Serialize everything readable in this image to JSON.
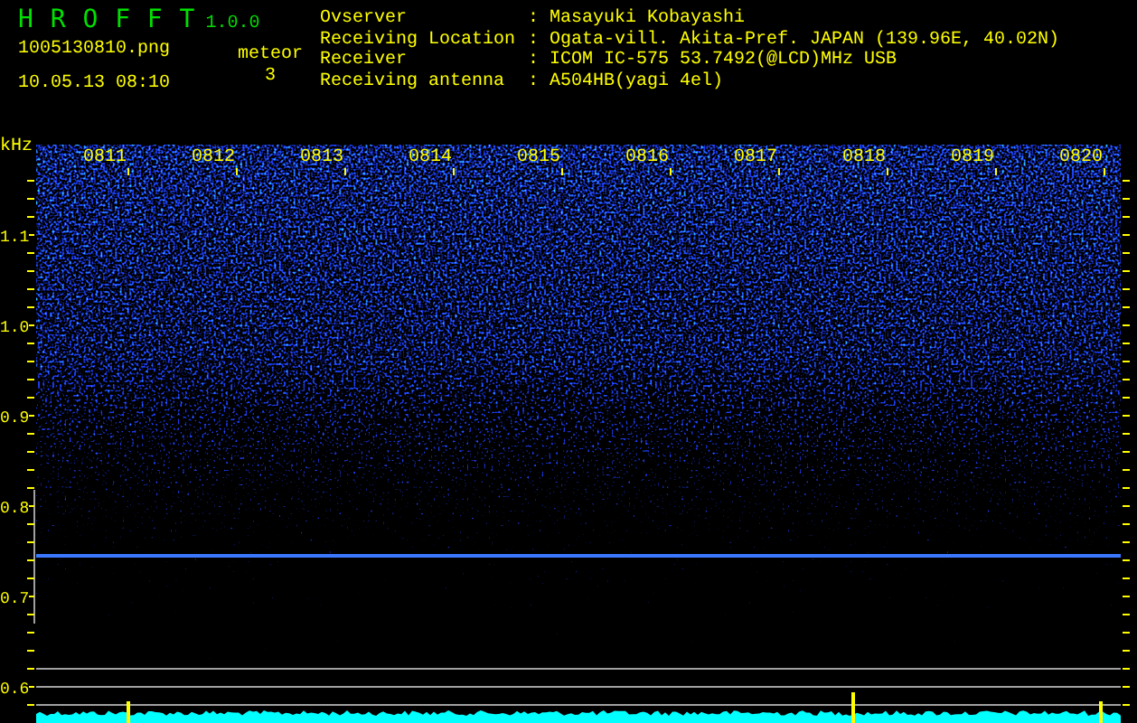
{
  "app": {
    "title": "H R O F F T",
    "version": "1.0.0"
  },
  "file": {
    "name": "1005130810.png",
    "datetime": "10.05.13 08:10"
  },
  "meteor": {
    "label": "meteor",
    "count": "3"
  },
  "info": [
    {
      "label": "Ovserver",
      "separator": ":",
      "value": "Masayuki Kobayashi"
    },
    {
      "label": "Receiving Location",
      "separator": ":",
      "value": "Ogata-vill. Akita-Pref. JAPAN (139.96E, 40.02N)"
    },
    {
      "label": "Receiver",
      "separator": ":",
      "value": "ICOM IC-575 53.7492(@LCD)MHz USB"
    },
    {
      "label": "Receiving antenna",
      "separator": ":",
      "value": "A504HB(yagi 4el)"
    }
  ],
  "plot": {
    "unit": "kHz",
    "freq_labels": [
      "1.1",
      "1.0",
      "0.9",
      "0.8",
      "0.7",
      "0.6"
    ],
    "time_labels": [
      "0811",
      "0812",
      "0813",
      "0814",
      "0815",
      "0816",
      "0817",
      "0818",
      "0819",
      "0820"
    ]
  }
}
